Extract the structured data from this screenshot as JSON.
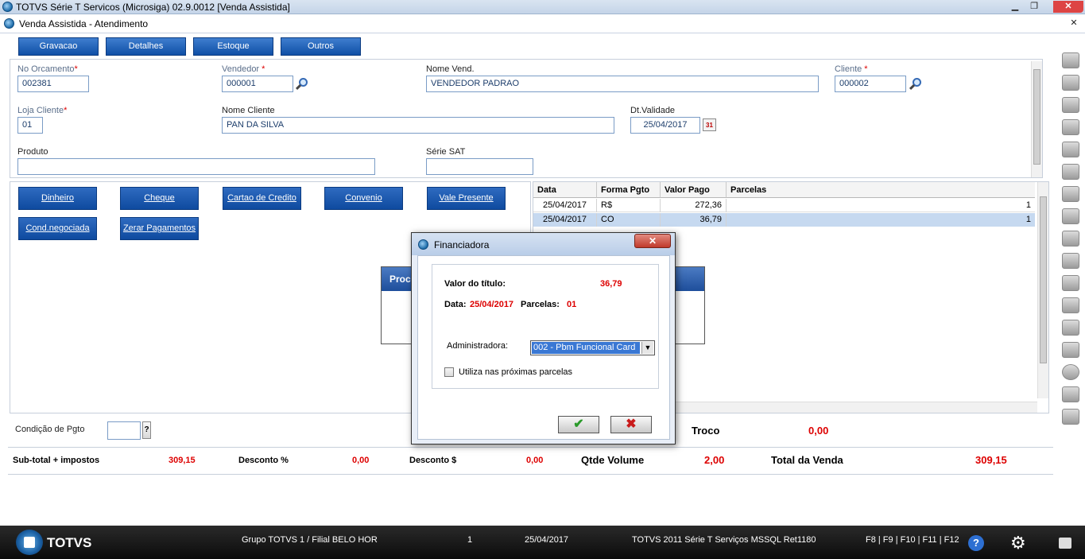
{
  "window": {
    "title": "TOTVS Série T Servicos (Microsiga) 02.9.0012 [Venda Assistida]",
    "subtitle": "Venda Assistida - Atendimento",
    "minimize": "▁",
    "restore": "❐",
    "close": "✕"
  },
  "menu": {
    "gravacao": "Gravacao",
    "detalhes": "Detalhes",
    "estoque": "Estoque",
    "outros": "Outros"
  },
  "form": {
    "no_orcamento": {
      "label": "No Orcamento",
      "value": "002381"
    },
    "vendedor": {
      "label": "Vendedor ",
      "value": "000001"
    },
    "nome_vend": {
      "label": "Nome Vend.",
      "value": "VENDEDOR PADRAO"
    },
    "cliente": {
      "label": "Cliente ",
      "value": "000002"
    },
    "loja_cliente": {
      "label": "Loja Cliente",
      "value": "01"
    },
    "nome_cliente": {
      "label": "Nome Cliente",
      "value": "PAN DA SILVA"
    },
    "dt_validade": {
      "label": "Dt.Validade",
      "value": "25/04/2017"
    },
    "calendar_icon_text": "31",
    "produto": {
      "label": "Produto",
      "value": ""
    },
    "serie_sat": {
      "label": "Série SAT",
      "value": ""
    },
    "required_mark": "*"
  },
  "payment_buttons": {
    "dinheiro": "Dinheiro",
    "cheque": "Cheque",
    "cartao": "Cartao de Credito",
    "convenio": "Convenio",
    "vale": "Vale Presente",
    "cond": "Cond.negociada",
    "zerar": "Zerar Pagamentos"
  },
  "grid": {
    "headers": {
      "data": "Data",
      "forma": "Forma Pgto",
      "valor": "Valor Pago",
      "parcelas": "Parcelas"
    },
    "rows": [
      {
        "data": "25/04/2017",
        "forma": "R$",
        "valor": "272,36",
        "parcelas": "1"
      },
      {
        "data": "25/04/2017",
        "forma": "CO",
        "valor": "36,79",
        "parcelas": "1"
      }
    ]
  },
  "background_dialog": {
    "title_fragment": "Proc"
  },
  "financiadora": {
    "title": "Financiadora",
    "valor_label": "Valor do título:",
    "valor": "36,79",
    "data_label": "Data:",
    "data": "25/04/2017",
    "parcelas_label": "Parcelas:",
    "parcelas": "01",
    "admin_label": "Administradora:",
    "admin_value": "002 - Pbm Funcional Card",
    "checkbox_label": "Utiliza nas próximas parcelas",
    "ok_glyph": "✔",
    "cancel_glyph": "✖"
  },
  "cond_pgto": {
    "label": "Condição de Pgto",
    "value": "",
    "help": "?"
  },
  "troco": {
    "label": "Troco",
    "value": "0,00"
  },
  "summary": {
    "subtotal_label": "Sub-total + impostos",
    "subtotal": "309,15",
    "desconto_pct_label": "Desconto %",
    "desconto_pct": "0,00",
    "desconto_val_label": "Desconto $",
    "desconto_val": "0,00",
    "qtde_label": "Qtde Volume",
    "qtde": "2,00",
    "total_label": "Total da Venda",
    "total": "309,15"
  },
  "statusbar": {
    "brand": "TOTVS",
    "grupo": "Grupo TOTVS 1 / Filial BELO HOR",
    "num": "1",
    "date": "25/04/2017",
    "env": "TOTVS 2011 Série T Serviços MSSQL Ret1180",
    "keys": "F8 | F9 | F10 | F11 | F12",
    "help": "?"
  },
  "colors": {
    "accent_blue": "#0e4a9f",
    "value_red": "#d00000",
    "selection": "#c6d9f0"
  }
}
